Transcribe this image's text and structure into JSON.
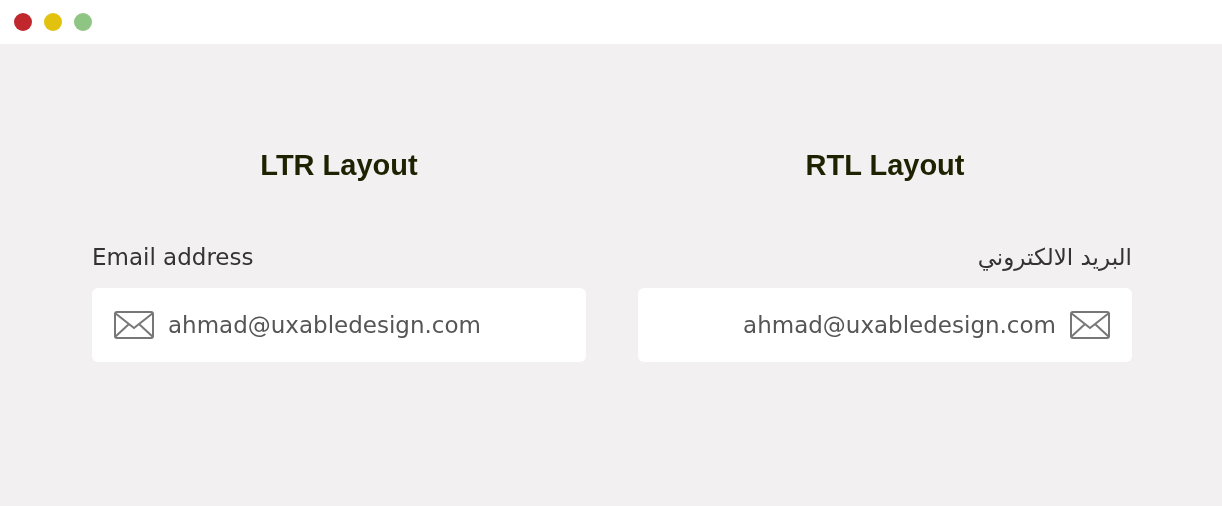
{
  "window": {
    "controls": [
      {
        "color": "#c0282d"
      },
      {
        "color": "#e2c20e"
      },
      {
        "color": "#8fc582"
      }
    ]
  },
  "panels": [
    {
      "heading": "LTR Layout",
      "kind": "ltr",
      "label": "Email address",
      "value": "ahmad@uxabledesign.com"
    },
    {
      "heading": "RTL Layout",
      "kind": "rtl",
      "label": "البريد الالكتروني",
      "value": "ahmad@uxabledesign.com"
    }
  ]
}
